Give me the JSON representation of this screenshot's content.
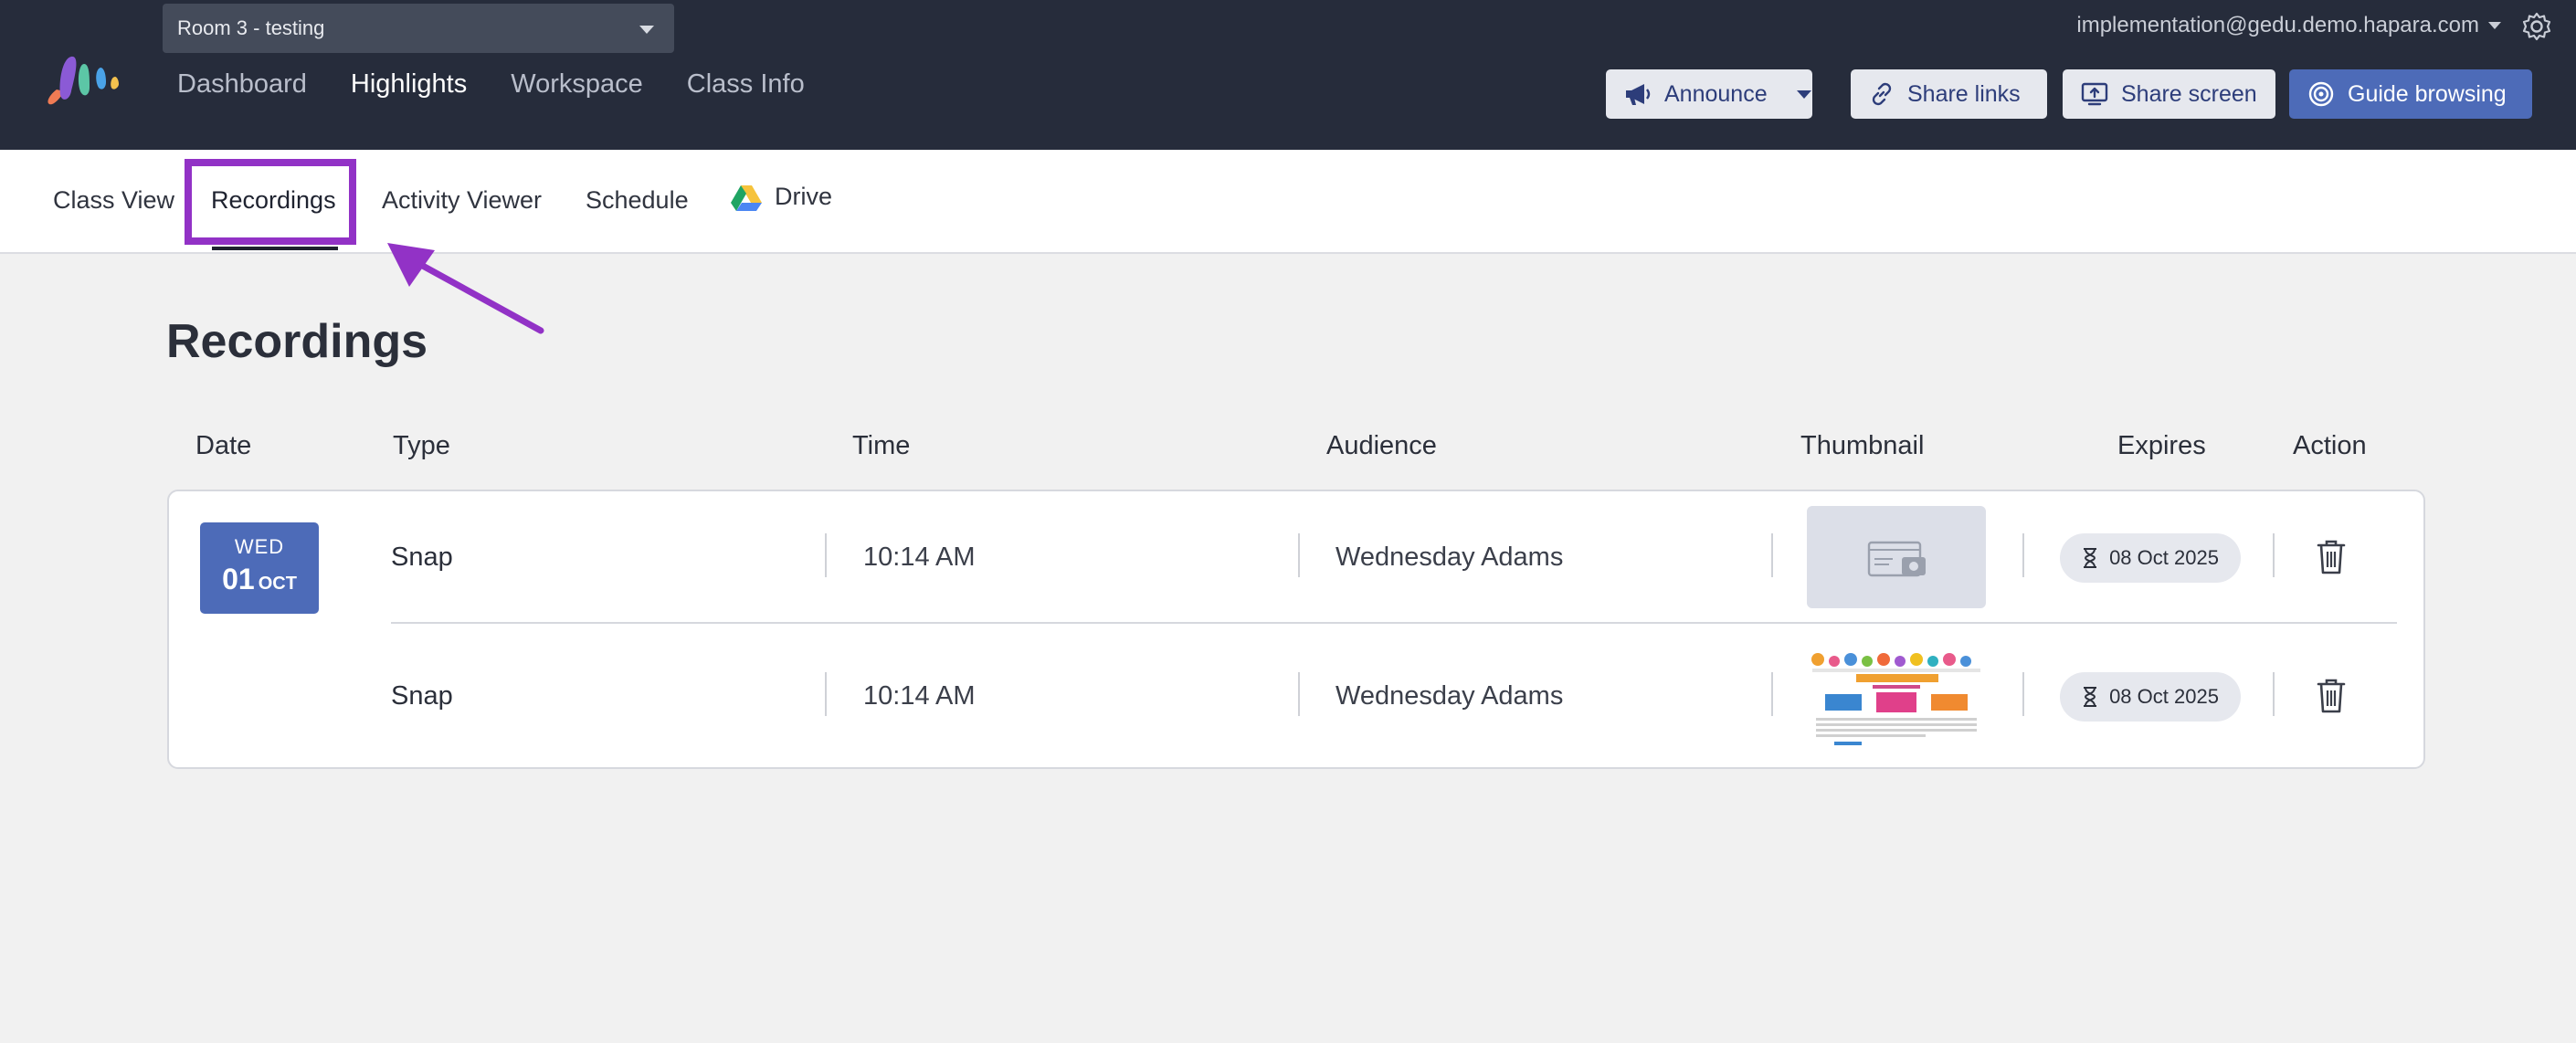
{
  "header": {
    "room_select": "Room 3 - testing",
    "nav": [
      "Dashboard",
      "Highlights",
      "Workspace",
      "Class Info"
    ],
    "active_nav": "Highlights",
    "account_email": "implementation@gedu.demo.hapara.com",
    "buttons": {
      "announce": "Announce",
      "share_links": "Share links",
      "share_screen": "Share screen",
      "guide_browsing": "Guide browsing"
    }
  },
  "subnav": {
    "tabs": [
      "Class View",
      "Recordings",
      "Activity Viewer",
      "Schedule",
      "Drive"
    ],
    "active_tab": "Recordings"
  },
  "page": {
    "title": "Recordings",
    "columns": [
      "Date",
      "Type",
      "Time",
      "Audience",
      "Thumbnail",
      "Expires",
      "Action"
    ]
  },
  "date_group": {
    "dow": "WED",
    "day": "01",
    "month": "OCT"
  },
  "recordings": [
    {
      "type": "Snap",
      "time": "10:14 AM",
      "audience": "Wednesday Adams",
      "thumbnail": "placeholder",
      "expires": "08 Oct 2025"
    },
    {
      "type": "Snap",
      "time": "10:14 AM",
      "audience": "Wednesday Adams",
      "thumbnail": "image",
      "expires": "08 Oct 2025"
    }
  ],
  "colors": {
    "header_bg": "#262c3b",
    "accent": "#4d6bb8",
    "highlight_annotation": "#9232c6"
  }
}
